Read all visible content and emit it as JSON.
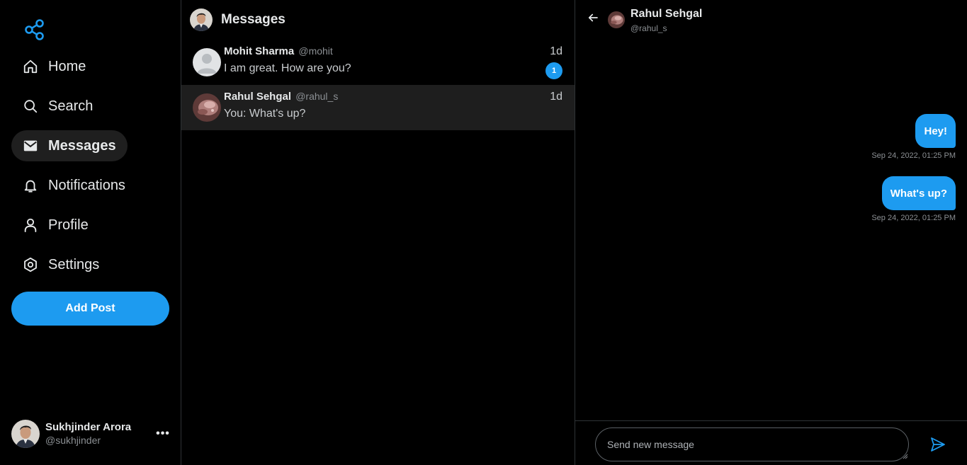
{
  "sidebar": {
    "logo_icon": "share-nodes-icon",
    "items": [
      {
        "label": "Home",
        "icon": "home-icon"
      },
      {
        "label": "Search",
        "icon": "search-icon"
      },
      {
        "label": "Messages",
        "icon": "envelope-icon",
        "active": true
      },
      {
        "label": "Notifications",
        "icon": "bell-icon"
      },
      {
        "label": "Profile",
        "icon": "user-icon"
      },
      {
        "label": "Settings",
        "icon": "gear-icon"
      }
    ],
    "add_post_label": "Add Post",
    "account": {
      "name": "Sukhjinder Arora",
      "handle": "@sukhjinder",
      "more_label": "•••"
    }
  },
  "messages_panel": {
    "title": "Messages",
    "conversations": [
      {
        "name": "Mohit Sharma",
        "handle": "@mohit",
        "preview": "I am great. How are you?",
        "time": "1d",
        "unread": "1",
        "active": false
      },
      {
        "name": "Rahul Sehgal",
        "handle": "@rahul_s",
        "preview": "You: What's up?",
        "time": "1d",
        "unread": "",
        "active": true
      }
    ]
  },
  "chat": {
    "name": "Rahul Sehgal",
    "handle": "@rahul_s",
    "messages": [
      {
        "text": "Hey!",
        "timestamp": "Sep 24, 2022, 01:25 PM"
      },
      {
        "text": "What's up?",
        "timestamp": "Sep 24, 2022, 01:25 PM"
      }
    ],
    "input_placeholder": "Send new message"
  },
  "colors": {
    "accent": "#1d9bf0",
    "background": "#000000",
    "active_row": "#1e1e1e"
  }
}
